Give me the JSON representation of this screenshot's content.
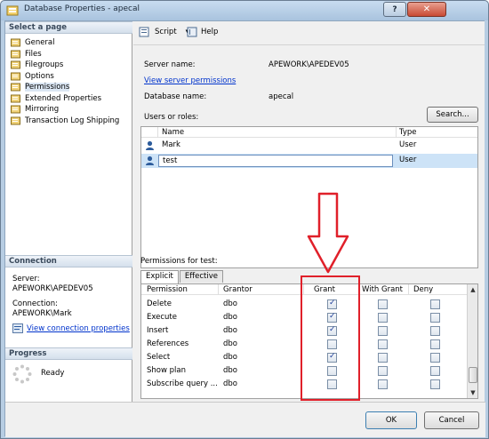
{
  "window": {
    "title": "Database Properties - apecal",
    "help_glyph": "?",
    "close_glyph": "✕"
  },
  "left": {
    "select_page_header": "Select a page",
    "pages": [
      {
        "label": "General"
      },
      {
        "label": "Files"
      },
      {
        "label": "Filegroups"
      },
      {
        "label": "Options"
      },
      {
        "label": "Permissions",
        "selected": true
      },
      {
        "label": "Extended Properties"
      },
      {
        "label": "Mirroring"
      },
      {
        "label": "Transaction Log Shipping"
      }
    ],
    "connection_header": "Connection",
    "server_label": "Server:",
    "server_value": "APEWORK\\APEDEV05",
    "connection_label": "Connection:",
    "connection_value": "APEWORK\\Mark",
    "view_connection_properties": "View connection properties",
    "progress_header": "Progress",
    "progress_status": "Ready"
  },
  "toolbar": {
    "script_label": "Script",
    "help_label": "Help"
  },
  "form": {
    "server_name_label": "Server name:",
    "server_name_value": "APEWORK\\APEDEV05",
    "view_server_permissions": "View server permissions",
    "database_name_label": "Database name:",
    "database_name_value": "apecal",
    "users_or_roles_label": "Users or roles:",
    "search_button": "Search..."
  },
  "users_grid": {
    "columns": [
      "Name",
      "Type"
    ],
    "rows": [
      {
        "name": "Mark",
        "type": "User",
        "selected": false
      },
      {
        "name": "test",
        "type": "User",
        "selected": true
      }
    ]
  },
  "permissions": {
    "label": "Permissions for test:",
    "tabs": [
      "Explicit",
      "Effective"
    ],
    "columns": [
      "Permission",
      "Grantor",
      "Grant",
      "With Grant",
      "Deny"
    ],
    "rows": [
      {
        "permission": "Delete",
        "grantor": "dbo",
        "grant": true,
        "with_grant": false,
        "deny": false
      },
      {
        "permission": "Execute",
        "grantor": "dbo",
        "grant": true,
        "with_grant": false,
        "deny": false
      },
      {
        "permission": "Insert",
        "grantor": "dbo",
        "grant": true,
        "with_grant": false,
        "deny": false
      },
      {
        "permission": "References",
        "grantor": "dbo",
        "grant": false,
        "with_grant": false,
        "deny": false
      },
      {
        "permission": "Select",
        "grantor": "dbo",
        "grant": true,
        "with_grant": false,
        "deny": false
      },
      {
        "permission": "Show plan",
        "grantor": "dbo",
        "grant": false,
        "with_grant": false,
        "deny": false
      },
      {
        "permission": "Subscribe query ...",
        "grantor": "dbo",
        "grant": false,
        "with_grant": false,
        "deny": false
      }
    ]
  },
  "footer": {
    "ok_label": "OK",
    "cancel_label": "Cancel"
  },
  "colors": {
    "annotation_red": "#e0202a",
    "selected_row": "#cde3f7",
    "link_blue": "#0033cc"
  }
}
